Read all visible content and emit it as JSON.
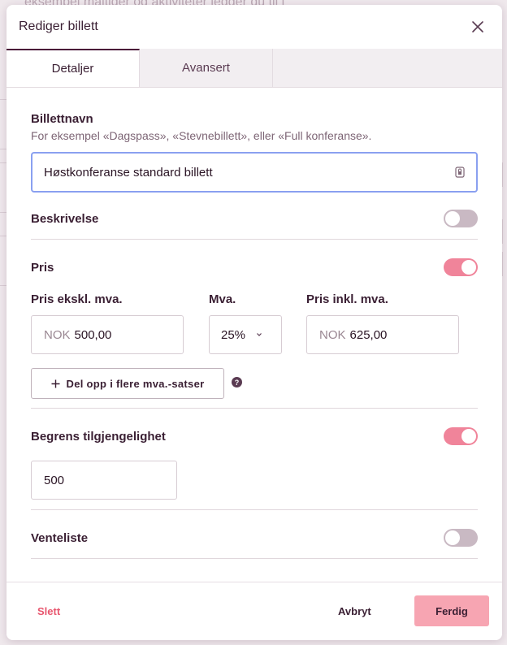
{
  "background": {
    "text": "eksempel måltider og aktiviteter legger du til i"
  },
  "modal": {
    "title": "Rediger billett",
    "tabs": [
      {
        "label": "Detaljer",
        "active": true
      },
      {
        "label": "Avansert",
        "active": false
      }
    ]
  },
  "ticket_name": {
    "label": "Billettnavn",
    "hint": "For eksempel «Dagspass», «Stevnebillett», eller «Full konferanse».",
    "value": "Høstkonferanse standard billett"
  },
  "description": {
    "label": "Beskrivelse",
    "enabled": false
  },
  "price": {
    "label": "Pris",
    "enabled": true,
    "excl_label": "Pris ekskl. mva.",
    "vat_label": "Mva.",
    "incl_label": "Pris inkl. mva.",
    "currency": "NOK",
    "excl_value": "500,00",
    "vat_value": "25%",
    "incl_value": "625,00",
    "split_button": "Del opp i flere mva.-satser",
    "help": "?"
  },
  "availability": {
    "label": "Begrens tilgjengelighet",
    "enabled": true,
    "value": "500"
  },
  "waitlist": {
    "label": "Venteliste",
    "enabled": false
  },
  "footer": {
    "delete": "Slett",
    "cancel": "Avbryt",
    "done": "Ferdig"
  },
  "colors": {
    "accent": "#4a1538",
    "toggle_on": "#f0849a",
    "toggle_off": "#c9b9c3",
    "primary_button": "#f7a5b2",
    "danger_text": "#e8566e",
    "focus_border": "#8aa0f0"
  },
  "icons": {
    "close": "close-icon",
    "password_manager": "keyboard-icon",
    "dropdown": "chevron-down-icon",
    "add": "plus-icon",
    "help": "help-icon"
  }
}
